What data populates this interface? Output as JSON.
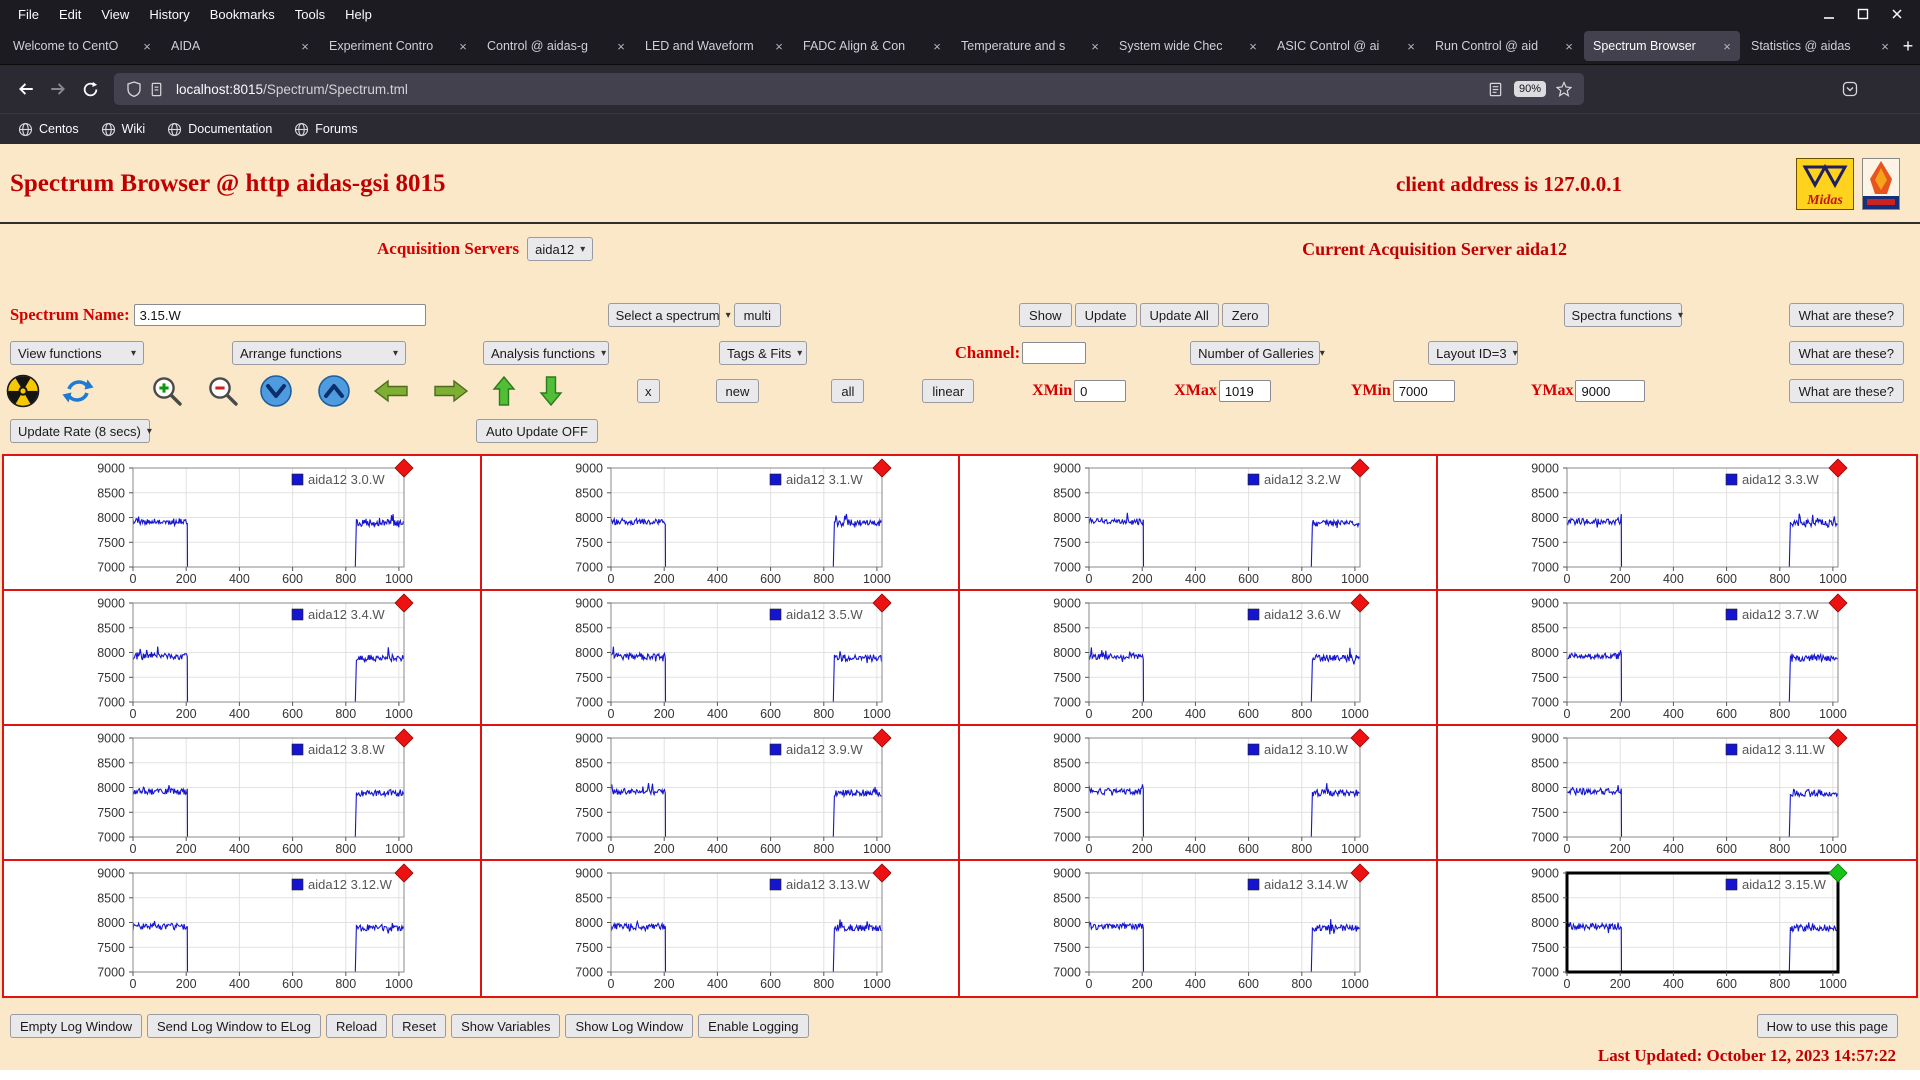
{
  "colors": {
    "page_bg": "#fbe8c8",
    "heading_red": "#c00000",
    "label_red": "#d40000",
    "grid_red": "#e01313",
    "plot_line": "#1515cf",
    "marker_default": "#ee1111",
    "marker_selected": "#16c316"
  },
  "browser": {
    "menubar": {
      "items": [
        "File",
        "Edit",
        "View",
        "History",
        "Bookmarks",
        "Tools",
        "Help"
      ]
    },
    "tab_close_glyph": "×",
    "new_tab_button": "+",
    "tabs": [
      {
        "label": "Welcome to CentO",
        "active": false
      },
      {
        "label": "AIDA",
        "active": false
      },
      {
        "label": "Experiment Contro",
        "active": false
      },
      {
        "label": "Control @ aidas-g",
        "active": false
      },
      {
        "label": "LED and Waveform",
        "active": false
      },
      {
        "label": "FADC Align & Con",
        "active": false
      },
      {
        "label": "Temperature and s",
        "active": false
      },
      {
        "label": "System wide Chec",
        "active": false
      },
      {
        "label": "ASIC Control @ ai",
        "active": false
      },
      {
        "label": "Run Control @ aid",
        "active": false
      },
      {
        "label": "Spectrum Browser",
        "active": true
      },
      {
        "label": "Statistics @ aidas",
        "active": false
      }
    ],
    "nav": {
      "url_host": "localhost:8015",
      "url_path": "/Spectrum/Spectrum.tml",
      "zoom_level": "90%"
    },
    "bookmarks": [
      {
        "label": "Centos"
      },
      {
        "label": "Wiki"
      },
      {
        "label": "Documentation"
      },
      {
        "label": "Forums"
      }
    ]
  },
  "header": {
    "title": "Spectrum Browser @ http aidas-gsi 8015",
    "client_address": "client address is 127.0.0.1",
    "midas_logo_text": "Midas"
  },
  "server_row": {
    "label": "Acquisition Servers",
    "selected": "aida12",
    "current": "Current Acquisition Server aida12"
  },
  "controls": {
    "spectrum_name_label": "Spectrum Name:",
    "spectrum_name_value": "3.15.W",
    "select_spectrum": "Select a spectrum",
    "multi": "multi",
    "show": "Show",
    "update": "Update",
    "update_all": "Update All",
    "zero": "Zero",
    "spectra_functions": "Spectra functions",
    "what_are_these": "What are these?",
    "view_functions": "View functions",
    "arrange_functions": "Arrange functions",
    "analysis_functions": "Analysis functions",
    "tags_fits": "Tags & Fits",
    "channel_label": "Channel:",
    "channel_value": "",
    "number_of_galleries": "Number of Galleries",
    "layout_id": "Layout ID=3",
    "x_btn": "x",
    "new_btn": "new",
    "all_btn": "all",
    "linear_btn": "linear",
    "xmin_label": "XMin",
    "xmin": "0",
    "xmax_label": "XMax",
    "xmax": "1019",
    "ymin_label": "YMin",
    "ymin": "7000",
    "ymax_label": "YMax",
    "ymax": "9000",
    "update_rate": "Update Rate (8 secs)",
    "auto_update": "Auto Update OFF"
  },
  "chart_data": {
    "type": "line",
    "title": "aida12 waveform spectra gallery",
    "x_ticks": [
      0,
      200,
      400,
      600,
      800,
      1000
    ],
    "y_ticks": [
      7000,
      7500,
      8000,
      8500,
      9000
    ],
    "xlim": [
      0,
      1019
    ],
    "ylim": [
      7000,
      9000
    ],
    "grid": true,
    "legend_position": "top-right",
    "selected_panel_index": 15,
    "waveform_segments": [
      {
        "x_start": 0,
        "x_end": 205,
        "level": 7920,
        "noise": 65
      },
      {
        "x_start": 205,
        "x_end": 836,
        "level": 7000,
        "noise": 0
      },
      {
        "x_start": 840,
        "x_end": 1019,
        "level": 7890,
        "noise": 70
      }
    ],
    "panels": [
      {
        "label": "aida12 3.0.W",
        "marker": "red"
      },
      {
        "label": "aida12 3.1.W",
        "marker": "red"
      },
      {
        "label": "aida12 3.2.W",
        "marker": "red"
      },
      {
        "label": "aida12 3.3.W",
        "marker": "red"
      },
      {
        "label": "aida12 3.4.W",
        "marker": "red"
      },
      {
        "label": "aida12 3.5.W",
        "marker": "red"
      },
      {
        "label": "aida12 3.6.W",
        "marker": "red"
      },
      {
        "label": "aida12 3.7.W",
        "marker": "red"
      },
      {
        "label": "aida12 3.8.W",
        "marker": "red"
      },
      {
        "label": "aida12 3.9.W",
        "marker": "red"
      },
      {
        "label": "aida12 3.10.W",
        "marker": "red"
      },
      {
        "label": "aida12 3.11.W",
        "marker": "red"
      },
      {
        "label": "aida12 3.12.W",
        "marker": "red"
      },
      {
        "label": "aida12 3.13.W",
        "marker": "red"
      },
      {
        "label": "aida12 3.14.W",
        "marker": "red"
      },
      {
        "label": "aida12 3.15.W",
        "marker": "green"
      }
    ]
  },
  "footer": {
    "buttons": [
      "Empty Log Window",
      "Send Log Window to ELog",
      "Reload",
      "Reset",
      "Show Variables",
      "Show Log Window",
      "Enable Logging"
    ],
    "help_button": "How to use this page",
    "last_updated": "Last Updated: October 12, 2023 14:57:22"
  }
}
